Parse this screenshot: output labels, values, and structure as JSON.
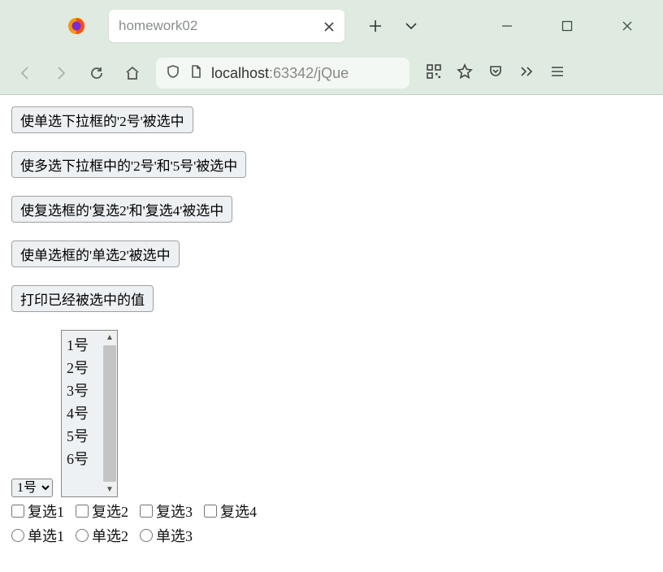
{
  "browser": {
    "tab_title": "homework02",
    "url_host": "localhost",
    "url_rest": ":63342/jQue"
  },
  "buttons": {
    "b1": "使单选下拉框的'2号'被选中",
    "b2": "使多选下拉框中的'2号'和'5号'被选中",
    "b3": "使复选框的'复选2'和'复选4'被选中",
    "b4": "使单选框的'单选2'被选中",
    "b5": "打印已经被选中的值"
  },
  "single_select": {
    "value": "1号"
  },
  "multi_select": {
    "options": [
      "1号",
      "2号",
      "3号",
      "4号",
      "5号",
      "6号"
    ]
  },
  "checkboxes": {
    "c1": "复选1",
    "c2": "复选2",
    "c3": "复选3",
    "c4": "复选4"
  },
  "radios": {
    "r1": "单选1",
    "r2": "单选2",
    "r3": "单选3"
  }
}
